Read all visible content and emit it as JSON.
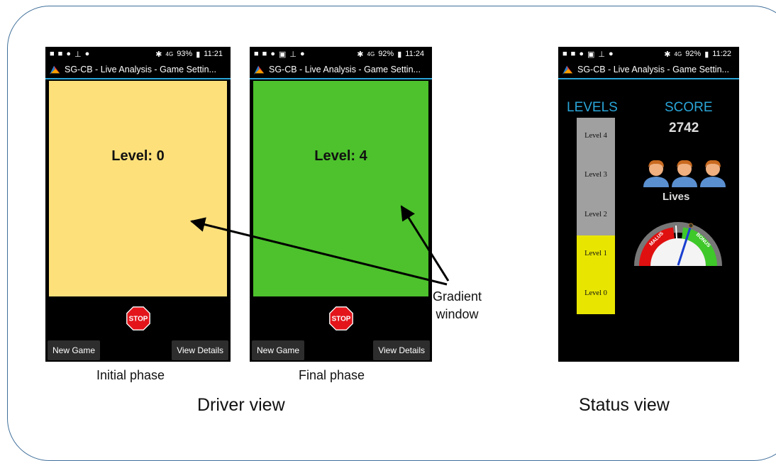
{
  "phones": [
    {
      "time": "11:21",
      "battery": "93%",
      "signal": "4G",
      "title": "SG-CB - Live Analysis - Game Settin...",
      "level_text": "Level: 0",
      "gradient_color": "#fde07a",
      "new_game_label": "New Game",
      "view_details_label": "View Details",
      "stop_label": "STOP",
      "caption": "Initial phase"
    },
    {
      "time": "11:24",
      "battery": "92%",
      "signal": "4G",
      "title": "SG-CB - Live Analysis - Game Settin...",
      "level_text": "Level: 4",
      "gradient_color": "#4dc22c",
      "new_game_label": "New Game",
      "view_details_label": "View Details",
      "stop_label": "STOP",
      "caption": "Final phase"
    }
  ],
  "status_phone": {
    "time": "11:22",
    "battery": "92%",
    "signal": "4G",
    "title": "SG-CB - Live Analysis - Game Settin...",
    "levels_header": "LEVELS",
    "score_header": "SCORE",
    "score_value": "2742",
    "lives_label": "Lives",
    "lives_count": 3,
    "levels": [
      {
        "label": "Level 4",
        "color": "#a0a0a0"
      },
      {
        "label": "Level 3",
        "color": "#a0a0a0"
      },
      {
        "label": "Level 2",
        "color": "#a0a0a0"
      },
      {
        "label": "Level 1",
        "color": "#e8e600"
      },
      {
        "label": "Level 0",
        "color": "#e8e600"
      }
    ],
    "gauge_malus": "MALUS",
    "gauge_bonus": "BONUS"
  },
  "annotation": {
    "line1": "Gradient",
    "line2": "window"
  },
  "driver_view_label": "Driver view",
  "status_view_label": "Status view",
  "colors": {
    "accent": "#2aa5d8",
    "frame": "#3f6f9a"
  }
}
